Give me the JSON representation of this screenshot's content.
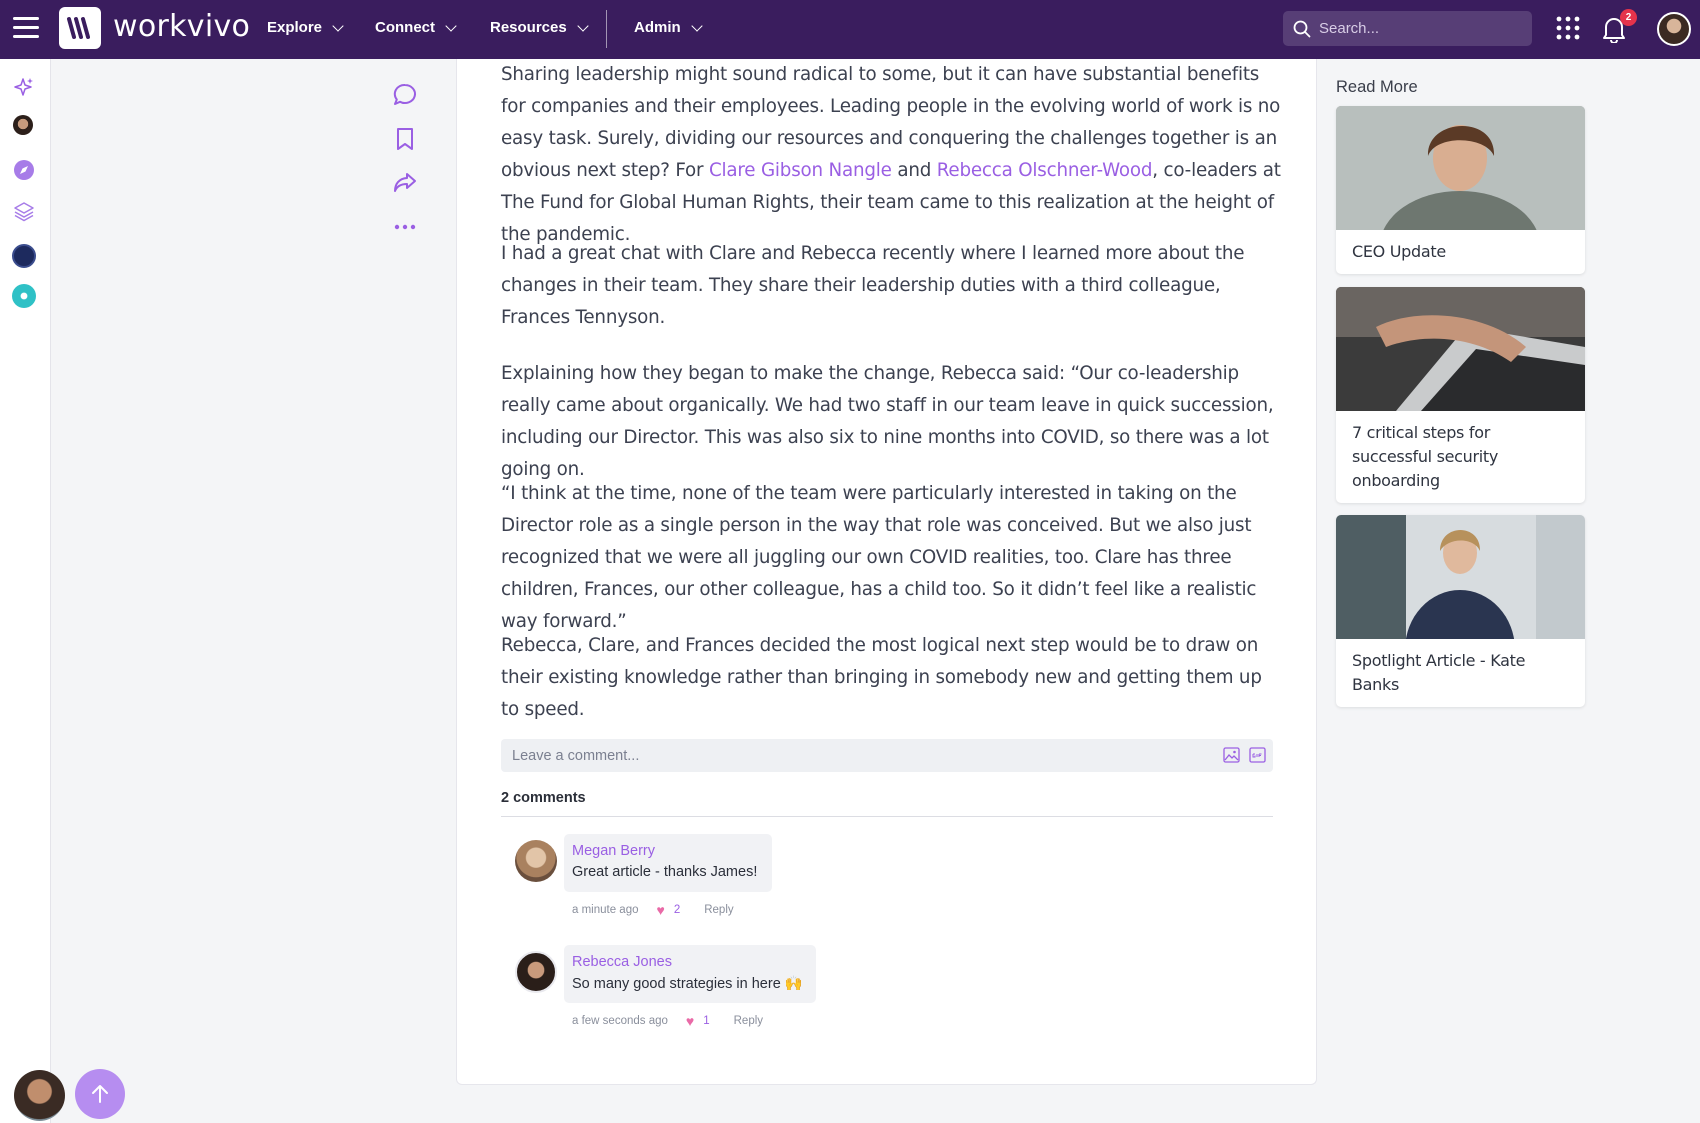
{
  "app": {
    "brand": "workvivo",
    "nav": [
      {
        "label": "Explore"
      },
      {
        "label": "Connect"
      },
      {
        "label": "Resources"
      },
      {
        "label": "Admin"
      }
    ],
    "search_placeholder": "Search...",
    "notification_count": "2"
  },
  "article": {
    "p1_a": "Sharing leadership might sound radical to some, but it can have substantial benefits for companies and their employees. Leading people in the evolving world of work is no easy task. Surely, dividing our resources and conquering the challenges together is an obvious next step? For ",
    "p1_link1": "Clare Gibson Nangle",
    "p1_b": " and ",
    "p1_link2": "Rebecca Olschner-Wood",
    "p1_c": ", co-leaders at The Fund for Global Human Rights, their team came to this realization at the height of the pandemic.",
    "p2": "I had a great chat with Clare and Rebecca recently where I learned more about the changes in their team. They share their leadership duties with a third colleague, Frances Tennyson.",
    "p3": "Explaining how they began to make the change, Rebecca said: “Our co-leadership really came about organically. We had two staff in our team leave in quick succession, including our Director. This was also six to nine months into COVID, so there was a lot going on.",
    "p4": "“I think at the time, none of the team were particularly interested in taking on the Director role as a single person in the way that role was conceived. But we also just recognized that we were all juggling our own COVID realities, too. Clare has three children, Frances, our other colleague, has a child too. So it didn’t feel like a realistic way forward.”",
    "p5": "Rebecca, Clare, and Frances decided the most logical next step would be to draw on their existing knowledge rather than bringing in somebody new and getting them up to speed."
  },
  "comments": {
    "placeholder": "Leave a comment...",
    "count_label": "2 comments",
    "items": [
      {
        "author": "Megan Berry",
        "text": "Great article - thanks James!",
        "time": "a minute ago",
        "likes": "2",
        "reply": "Reply"
      },
      {
        "author": "Rebecca Jones",
        "text": "So many good strategies in here 🙌",
        "time": "a few seconds ago",
        "likes": "1",
        "reply": "Reply"
      }
    ]
  },
  "read_more": {
    "title": "Read More",
    "items": [
      {
        "title": "CEO Update"
      },
      {
        "title": "7 critical steps for successful security onboarding"
      },
      {
        "title": "Spotlight Article - Kate Banks"
      }
    ]
  },
  "colors": {
    "topbar": "#3a1d5e",
    "accent": "#9a5fe3",
    "heart": "#e96aa7",
    "badge": "#e5334b"
  }
}
